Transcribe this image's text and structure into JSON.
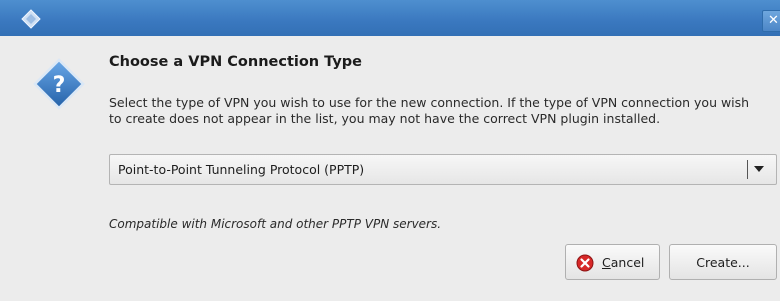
{
  "dialog": {
    "heading": "Choose a VPN Connection Type",
    "description": "Select the type of VPN you wish to use for the new connection.  If the type of VPN connection you wish\nto create does not appear in the list, you may not have the correct VPN plugin installed.",
    "vpn_type_select": {
      "selected": "Point-to-Point Tunneling Protocol (PPTP)"
    },
    "hint": "Compatible with Microsoft and other PPTP VPN servers.",
    "buttons": {
      "cancel_label": "Cancel",
      "create_label": "Create..."
    },
    "titlebar": {
      "close_glyph": "✕"
    }
  },
  "icons": {
    "window_icon": "diamond-icon",
    "dialog_icon": "question-icon",
    "cancel_icon": "cancel-icon",
    "dropdown_arrow": "chevron-down-icon"
  },
  "colors": {
    "titlebar": "#3a78bf",
    "dialog_bg": "#ececec",
    "question_icon": "#2f74c0",
    "cancel_icon": "#d72828"
  }
}
